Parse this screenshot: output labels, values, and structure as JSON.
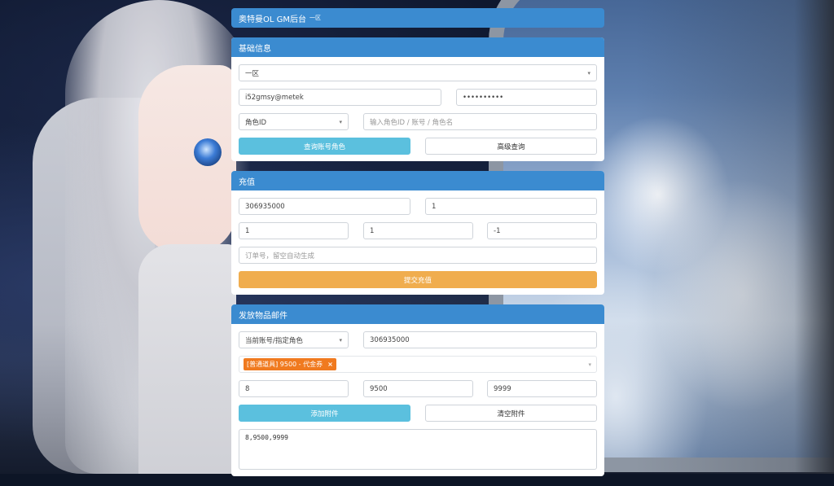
{
  "header": {
    "title": "奥特曼OL GM后台",
    "subtitle": "一区"
  },
  "basic": {
    "title": "基础信息",
    "server_select": "一区",
    "account": "i52gmsy@metek",
    "password": "••••••••••",
    "role_type_select": "角色ID",
    "role_search_placeholder": "输入角色ID / 账号 / 角色名",
    "query_button": "查询账号角色",
    "advanced_button": "高级查询"
  },
  "recharge": {
    "title": "充值",
    "role_id": "306935000",
    "amount": "1",
    "field_a": "1",
    "field_b": "1",
    "field_c": "-1",
    "order_placeholder": "订单号，留空自动生成",
    "submit_button": "提交充值"
  },
  "mail": {
    "title": "发放物品邮件",
    "target_select": "当前账号/指定角色",
    "target_id": "306935000",
    "item_tag": "[普通道具] 9500 - 代金券",
    "count": "8",
    "item_id": "9500",
    "max": "9999",
    "add_button": "添加附件",
    "clear_button": "清空附件",
    "attachments_text": "8,9500,9999"
  },
  "icons": {
    "chevron": "chevron-down-icon",
    "tag_remove": "close-icon"
  },
  "colors": {
    "primary": "#3b8bd0",
    "info": "#5bc0de",
    "warning": "#f0ad4e",
    "tag": "#f07a1f"
  }
}
